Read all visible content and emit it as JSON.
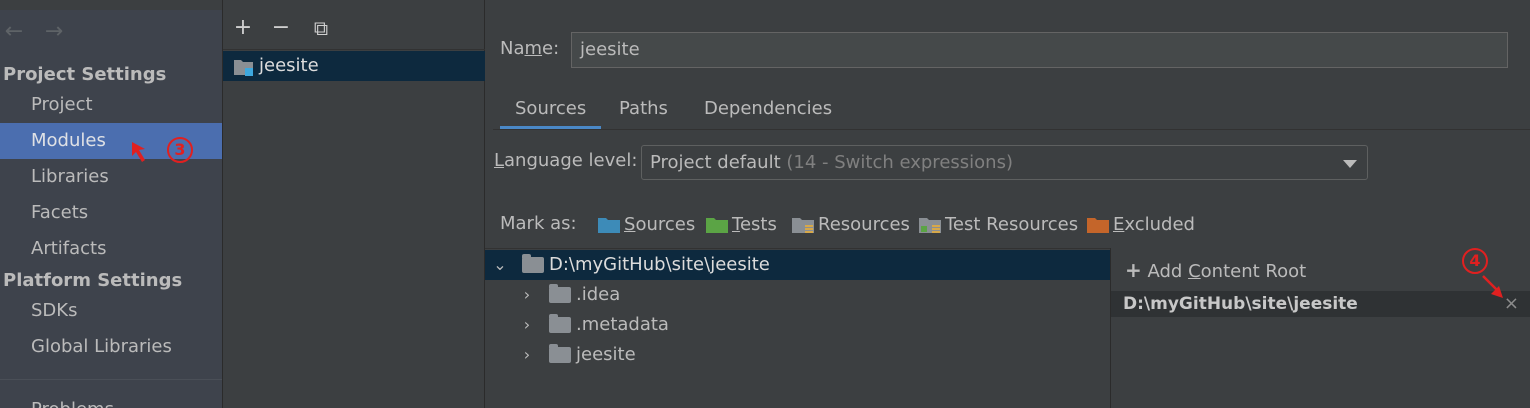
{
  "sidebar": {
    "nav_back": "←",
    "nav_forward": "→",
    "project_settings_header": "Project Settings",
    "project_items": [
      "Project",
      "Modules",
      "Libraries",
      "Facets",
      "Artifacts"
    ],
    "platform_settings_header": "Platform Settings",
    "platform_items": [
      "SDKs",
      "Global Libraries"
    ],
    "problems_label": "Problems"
  },
  "modules_panel": {
    "toolbar": {
      "add": "+",
      "remove": "−",
      "copy": "⧉"
    },
    "module_name": "jeesite"
  },
  "detail": {
    "name_label_pre": "Na",
    "name_label_mnemonic": "m",
    "name_label_post": "e:",
    "name_value": "jeesite",
    "tabs": [
      "Sources",
      "Paths",
      "Dependencies"
    ],
    "language_level_label_mnemonic": "L",
    "language_level_label_rest": "anguage level:",
    "language_level_value": "Project default",
    "language_level_hint": "(14 - Switch expressions)",
    "mark_as_label": "Mark as:",
    "mark_as": [
      {
        "mnemonic": "S",
        "rest": "ources",
        "color": "#3d8bb8"
      },
      {
        "mnemonic": "T",
        "rest": "ests",
        "color": "#5ba445"
      },
      {
        "mnemonic": "",
        "rest": "Resources",
        "color": "#8a8f94"
      },
      {
        "mnemonic": "",
        "rest": "Test Resources",
        "color": "#8a8f94"
      },
      {
        "mnemonic": "E",
        "rest": "xcluded",
        "color": "#c4652a"
      }
    ],
    "tree": {
      "root": "D:\\myGitHub\\site\\jeesite",
      "children": [
        ".idea",
        ".metadata",
        "jeesite"
      ]
    },
    "content_roots": {
      "add_pre": "Add ",
      "add_mnemonic": "C",
      "add_post": "ontent Root",
      "root_path": "D:\\myGitHub\\site\\jeesite",
      "remove_glyph": "×"
    }
  },
  "annotations": {
    "step3": "3",
    "step4": "4",
    "color": "#e02020"
  },
  "colors": {
    "selection": "#4b6eaf",
    "tree_selection": "#0d293e",
    "tab_underline": "#4a88c7"
  }
}
